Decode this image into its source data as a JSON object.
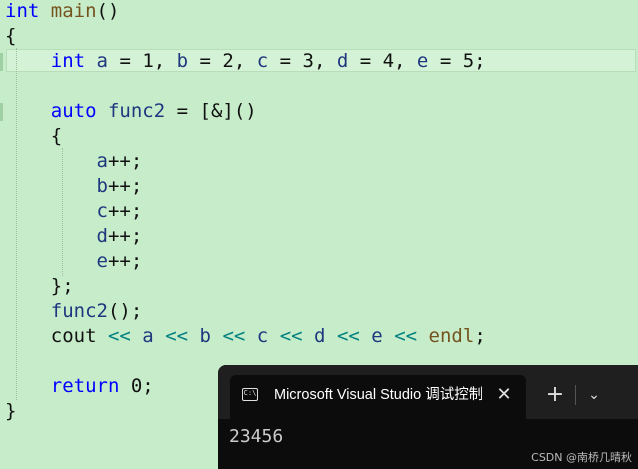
{
  "editor": {
    "lines": [
      {
        "tokens": [
          {
            "t": "int",
            "c": "kw"
          },
          {
            "t": " "
          },
          {
            "t": "main",
            "c": "fn"
          },
          {
            "t": "()"
          }
        ]
      },
      {
        "tokens": [
          {
            "t": "{"
          }
        ]
      },
      {
        "tokens": [
          {
            "t": "    "
          },
          {
            "t": "int",
            "c": "kw"
          },
          {
            "t": " "
          },
          {
            "t": "a",
            "c": "var"
          },
          {
            "t": " = 1, "
          },
          {
            "t": "b",
            "c": "var"
          },
          {
            "t": " = 2, "
          },
          {
            "t": "c",
            "c": "var"
          },
          {
            "t": " = 3, "
          },
          {
            "t": "d",
            "c": "var"
          },
          {
            "t": " = 4, "
          },
          {
            "t": "e",
            "c": "var"
          },
          {
            "t": " = 5;"
          }
        ]
      },
      {
        "tokens": []
      },
      {
        "tokens": [
          {
            "t": "    "
          },
          {
            "t": "auto",
            "c": "kw"
          },
          {
            "t": " "
          },
          {
            "t": "func2",
            "c": "var"
          },
          {
            "t": " = [&]()"
          }
        ]
      },
      {
        "tokens": [
          {
            "t": "    {"
          }
        ]
      },
      {
        "tokens": [
          {
            "t": "        "
          },
          {
            "t": "a",
            "c": "var"
          },
          {
            "t": "++;"
          }
        ]
      },
      {
        "tokens": [
          {
            "t": "        "
          },
          {
            "t": "b",
            "c": "var"
          },
          {
            "t": "++;"
          }
        ]
      },
      {
        "tokens": [
          {
            "t": "        "
          },
          {
            "t": "c",
            "c": "var"
          },
          {
            "t": "++;"
          }
        ]
      },
      {
        "tokens": [
          {
            "t": "        "
          },
          {
            "t": "d",
            "c": "var"
          },
          {
            "t": "++;"
          }
        ]
      },
      {
        "tokens": [
          {
            "t": "        "
          },
          {
            "t": "e",
            "c": "var"
          },
          {
            "t": "++;"
          }
        ]
      },
      {
        "tokens": [
          {
            "t": "    };"
          }
        ]
      },
      {
        "tokens": [
          {
            "t": "    "
          },
          {
            "t": "func2",
            "c": "var"
          },
          {
            "t": "();"
          }
        ]
      },
      {
        "tokens": [
          {
            "t": "    cout "
          },
          {
            "t": "<<",
            "c": "op"
          },
          {
            "t": " "
          },
          {
            "t": "a",
            "c": "var"
          },
          {
            "t": " "
          },
          {
            "t": "<<",
            "c": "op"
          },
          {
            "t": " "
          },
          {
            "t": "b",
            "c": "var"
          },
          {
            "t": " "
          },
          {
            "t": "<<",
            "c": "op"
          },
          {
            "t": " "
          },
          {
            "t": "c",
            "c": "var"
          },
          {
            "t": " "
          },
          {
            "t": "<<",
            "c": "op"
          },
          {
            "t": " "
          },
          {
            "t": "d",
            "c": "var"
          },
          {
            "t": " "
          },
          {
            "t": "<<",
            "c": "op"
          },
          {
            "t": " "
          },
          {
            "t": "e",
            "c": "var"
          },
          {
            "t": " "
          },
          {
            "t": "<<",
            "c": "op"
          },
          {
            "t": " "
          },
          {
            "t": "endl",
            "c": "fn"
          },
          {
            "t": ";"
          }
        ]
      },
      {
        "tokens": []
      },
      {
        "tokens": [
          {
            "t": "    "
          },
          {
            "t": "return",
            "c": "kw"
          },
          {
            "t": " 0;"
          }
        ]
      },
      {
        "tokens": [
          {
            "t": "}"
          }
        ]
      }
    ]
  },
  "console": {
    "tab_title": "Microsoft Visual Studio 调试控制台",
    "tab_icon": "terminal-icon",
    "tab_icon_glyph": "C:\\",
    "close_glyph": "✕",
    "new_tab_glyph": "+",
    "dropdown_glyph": "⌄",
    "output": "23456"
  },
  "watermark": "CSDN @南桥几晴秋",
  "colors": {
    "editor_background": "#c7ecca",
    "keyword": "#0000ff",
    "function": "#74531f",
    "variable": "#1f377f",
    "operator": "#008080",
    "console_background": "#0c0c0c",
    "tab_bar": "#1f1f1f"
  }
}
